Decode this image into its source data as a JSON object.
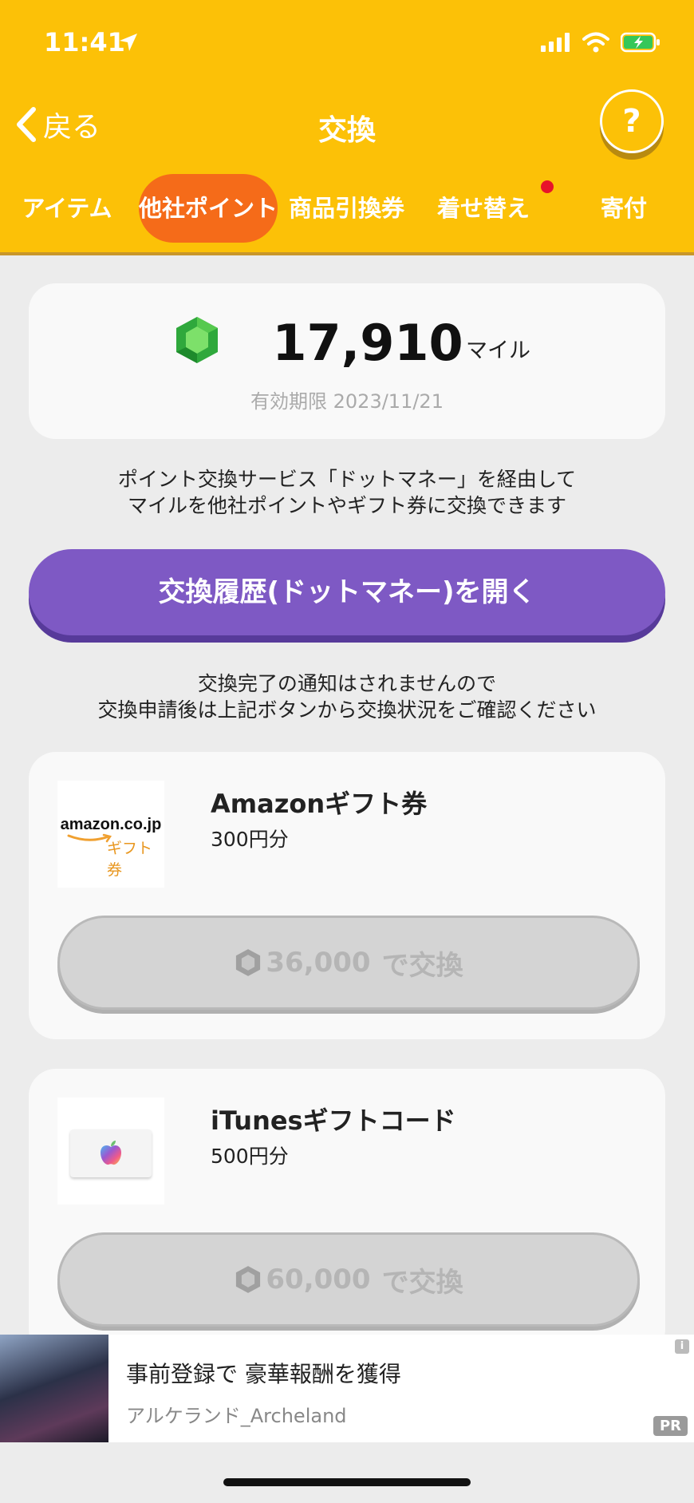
{
  "status_bar": {
    "time": "11:41"
  },
  "nav": {
    "back_label": "戻る",
    "title": "交換",
    "help_label": "?"
  },
  "tabs": [
    {
      "label": "アイテム",
      "active": false
    },
    {
      "label": "他社ポイント",
      "active": true
    },
    {
      "label": "商品引換券",
      "active": false
    },
    {
      "label": "着せ替え",
      "active": false,
      "badge": true
    },
    {
      "label": "寄付",
      "active": false
    }
  ],
  "miles": {
    "value": "17,910",
    "unit": "マイル",
    "expiry": "有効期限 2023/11/21"
  },
  "description": {
    "line1": "ポイント交換サービス「ドットマネー」を経由して",
    "line2": "マイルを他社ポイントやギフト券に交換できます"
  },
  "history_button": "交換履歴(ドットマネー)を開く",
  "notice": {
    "line1": "交換完了の通知はされませんので",
    "line2": "交換申請後は上記ボタンから交換状況をご確認ください"
  },
  "products": [
    {
      "name": "Amazonギフト券",
      "price": "300円分",
      "logo_main": "amazon.co.jp",
      "logo_sub": "ギフト券",
      "cost": "36,000",
      "action": "で交換"
    },
    {
      "name": "iTunesギフトコード",
      "price": "500円分",
      "cost": "60,000",
      "action": "で交換"
    }
  ],
  "ad": {
    "title": "事前登録で 豪華報酬を獲得",
    "subtitle": "アルケランド_Archeland",
    "pr": "PR",
    "info": "i"
  },
  "colors": {
    "header": "#fcc107",
    "active_tab": "#f56b19",
    "history_button": "#7e59c4",
    "badge": "#e8132a"
  }
}
